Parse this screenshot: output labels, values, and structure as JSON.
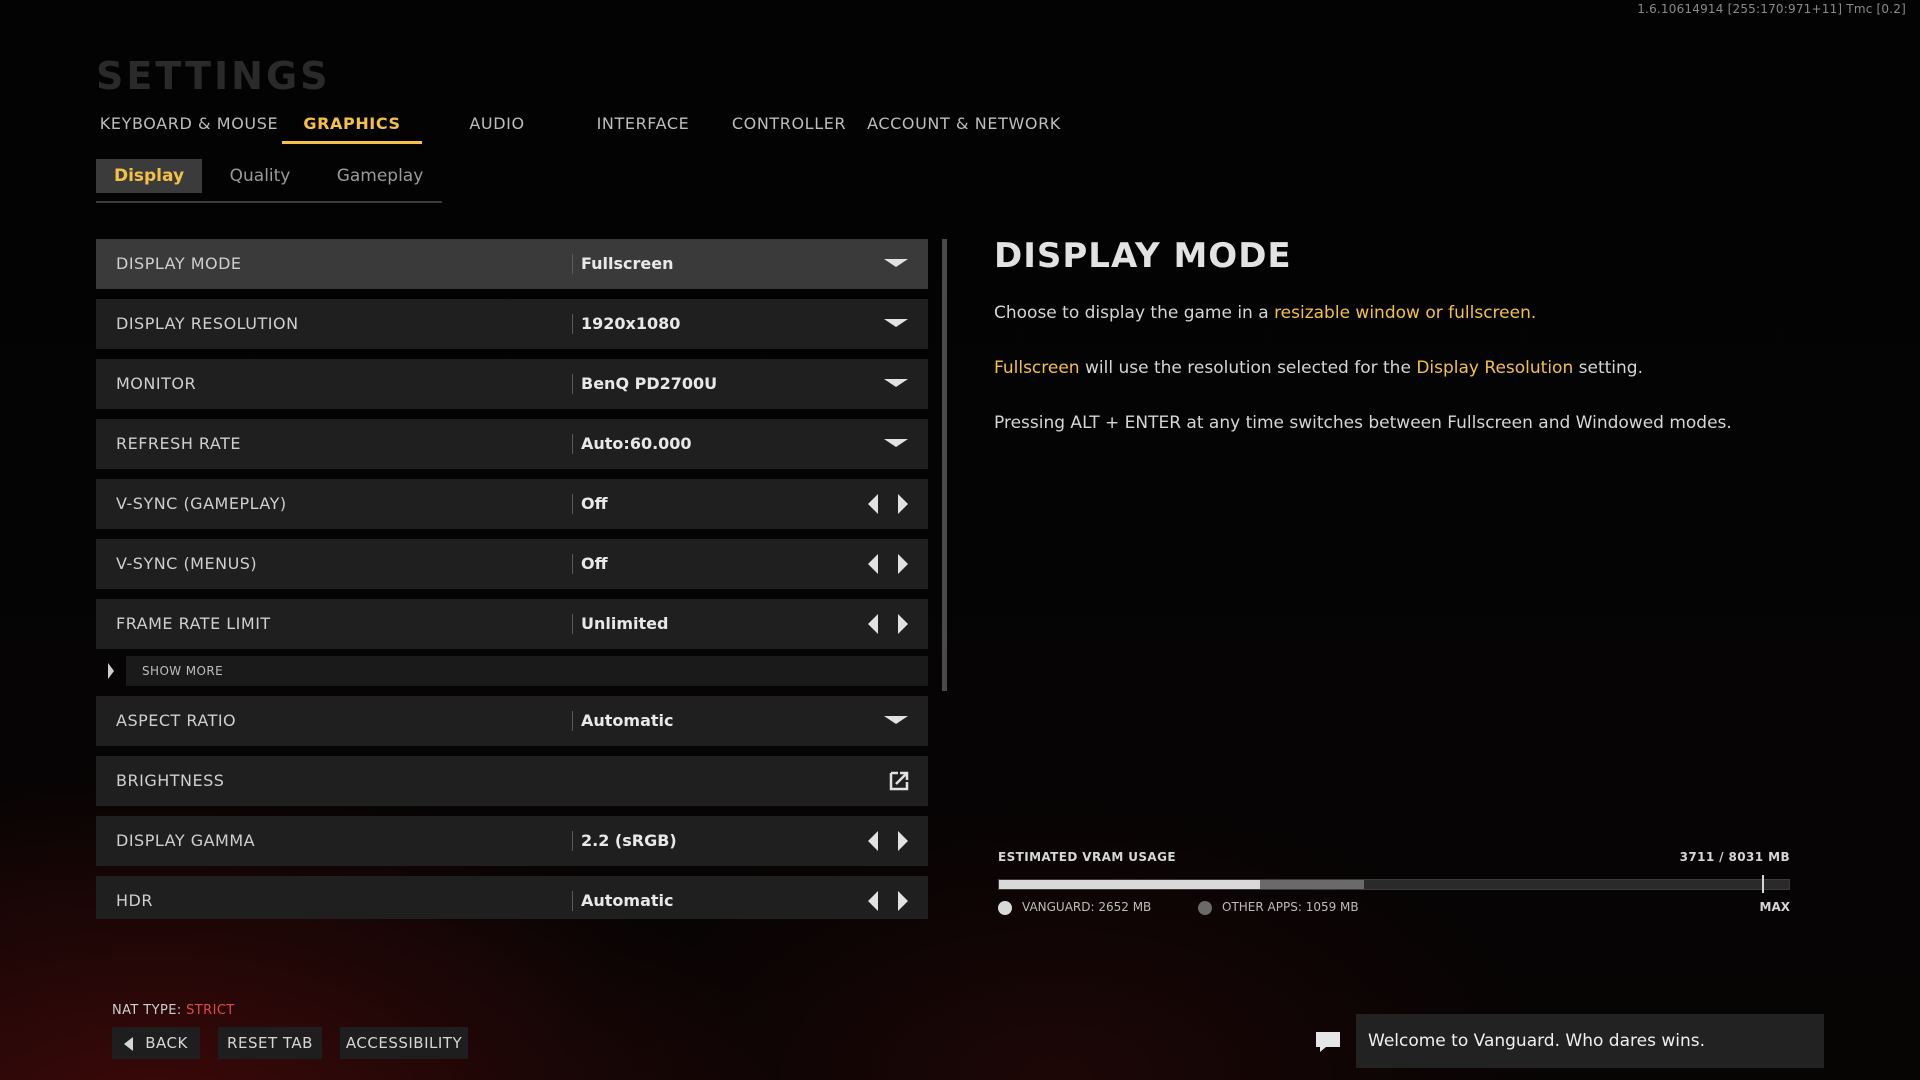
{
  "build_info": "1.6.10614914 [255:170:971+11] Tmc [0.2]",
  "page_title": "SETTINGS",
  "main_tabs": [
    {
      "label": "KEYBOARD & MOUSE",
      "active": false
    },
    {
      "label": "GRAPHICS",
      "active": true
    },
    {
      "label": "AUDIO",
      "active": false
    },
    {
      "label": "INTERFACE",
      "active": false
    },
    {
      "label": "CONTROLLER",
      "active": false
    },
    {
      "label": "ACCOUNT & NETWORK",
      "active": false
    }
  ],
  "sub_tabs": [
    {
      "label": "Display",
      "active": true
    },
    {
      "label": "Quality",
      "active": false
    },
    {
      "label": "Gameplay",
      "active": false
    }
  ],
  "settings": [
    {
      "label": "DISPLAY MODE",
      "value": "Fullscreen",
      "control": "dropdown",
      "selected": true
    },
    {
      "label": "DISPLAY RESOLUTION",
      "value": "1920x1080",
      "control": "dropdown"
    },
    {
      "label": "MONITOR",
      "value": "BenQ PD2700U",
      "control": "dropdown"
    },
    {
      "label": "REFRESH RATE",
      "value": "Auto:60.000",
      "control": "dropdown"
    },
    {
      "label": "V-SYNC (GAMEPLAY)",
      "value": "Off",
      "control": "stepper"
    },
    {
      "label": "V-SYNC (MENUS)",
      "value": "Off",
      "control": "stepper"
    },
    {
      "label": "FRAME RATE LIMIT",
      "value": "Unlimited",
      "control": "stepper"
    }
  ],
  "show_more_label": "SHOW MORE",
  "settings_more": [
    {
      "label": "ASPECT RATIO",
      "value": "Automatic",
      "control": "dropdown"
    },
    {
      "label": "BRIGHTNESS",
      "value": "",
      "control": "external-link"
    },
    {
      "label": "DISPLAY GAMMA",
      "value": "2.2 (sRGB)",
      "control": "stepper"
    },
    {
      "label": "HDR",
      "value": "Automatic",
      "control": "stepper"
    }
  ],
  "description": {
    "title": "DISPLAY MODE",
    "p1_text": "Choose to display the game in a ",
    "p1_highlight": "resizable window or fullscreen",
    "p1_end": ".",
    "p2_highlight1": "Fullscreen",
    "p2_text": " will use the resolution selected for the ",
    "p2_highlight2": "Display Resolution",
    "p2_end": " setting.",
    "p3_text": "Pressing ALT + ENTER at any time switches between Fullscreen and Windowed modes."
  },
  "vram": {
    "label": "ESTIMATED VRAM USAGE",
    "total_text": "3711 / 8031 MB",
    "total_mb": 8031,
    "vanguard_mb": 2652,
    "other_mb": 1059,
    "max_fraction": 0.966,
    "vanguard_label": "VANGUARD: 2652 MB",
    "other_label": "OTHER APPS: 1059 MB",
    "max_label": "MAX",
    "vanguard_color": "#d9d9d9",
    "other_color": "#6a6a6a"
  },
  "nat": {
    "label": "NAT TYPE:",
    "value": "STRICT",
    "value_color": "#e24b4b"
  },
  "footer": {
    "back": "BACK",
    "reset": "RESET TAB",
    "accessibility": "ACCESSIBILITY"
  },
  "chat": {
    "message": "Welcome to Vanguard. Who dares wins.",
    "icon": "chat-bubble-icon"
  },
  "colors": {
    "accent": "#f5c04a"
  }
}
